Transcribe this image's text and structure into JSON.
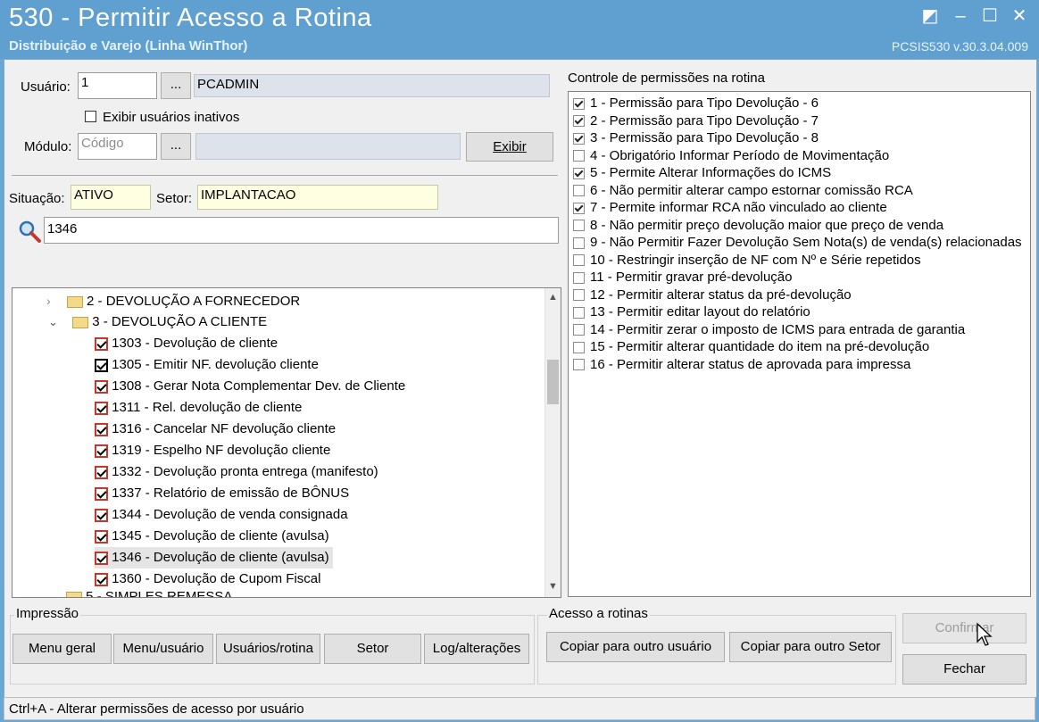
{
  "window": {
    "title": "530 - Permitir Acesso a Rotina",
    "subtitle": "Distribuição e Varejo (Linha WinThor)",
    "version": "PCSIS530  v.30.3.04.009"
  },
  "user": {
    "label": "Usuário:",
    "code": "1",
    "lookup_label": "...",
    "name": "PCADMIN",
    "show_inactive_label": "Exibir usuários inativos",
    "show_inactive": false
  },
  "module": {
    "label": "Módulo:",
    "code_placeholder": "Código",
    "lookup_label": "...",
    "name": "",
    "show_button": "Exibir"
  },
  "status": {
    "situacao_label": "Situação:",
    "situacao": "ATIVO",
    "setor_label": "Setor:",
    "setor": "IMPLANTACAO"
  },
  "search": {
    "value": "1346"
  },
  "tree": {
    "folders": [
      {
        "label": "2 - DEVOLUÇÃO A FORNECEDOR",
        "expanded": false
      },
      {
        "label": "3 - DEVOLUÇÃO A CLIENTE",
        "expanded": true
      },
      {
        "label": "5 - SIMPLES REMESSA",
        "expanded": false
      }
    ],
    "items": [
      {
        "label": "1303 - Devolução de cliente",
        "checked": true
      },
      {
        "label": "1305 - Emitir NF. devolução cliente",
        "checked": true
      },
      {
        "label": "1308 - Gerar Nota Complementar Dev. de Cliente",
        "checked": true
      },
      {
        "label": "1311 - Rel. devolução de cliente",
        "checked": true
      },
      {
        "label": "1316 - Cancelar NF devolução cliente",
        "checked": true
      },
      {
        "label": "1319 - Espelho NF devolução cliente",
        "checked": true
      },
      {
        "label": "1332 - Devolução pronta entrega (manifesto)",
        "checked": true
      },
      {
        "label": "1337 - Relatório de emissão de BÔNUS",
        "checked": true
      },
      {
        "label": "1344 - Devolução de venda consignada",
        "checked": true
      },
      {
        "label": "1345 - Devolução de cliente (avulsa)",
        "checked": true
      },
      {
        "label": "1346 - Devolução de cliente (avulsa)",
        "checked": true
      },
      {
        "label": "1360 - Devolução de Cupom Fiscal",
        "checked": true
      }
    ]
  },
  "permissions": {
    "title": "Controle de permissões na rotina",
    "items": [
      {
        "label": "1 - Permissão para Tipo Devolução - 6",
        "checked": true
      },
      {
        "label": "2 - Permissão para Tipo Devolução - 7",
        "checked": true
      },
      {
        "label": "3 - Permissão para Tipo Devolução - 8",
        "checked": true
      },
      {
        "label": "4 - Obrigatório Informar Período de Movimentação",
        "checked": false
      },
      {
        "label": "5 - Permite Alterar Informações do ICMS",
        "checked": true
      },
      {
        "label": "6 - Não permitir alterar campo estornar comissão RCA",
        "checked": false
      },
      {
        "label": "7 - Permite informar RCA não vinculado ao cliente",
        "checked": true
      },
      {
        "label": "8 - Não permitir preço devolução maior que preço de venda",
        "checked": false
      },
      {
        "label": "9 - Não Permitir Fazer Devolução Sem Nota(s) de venda(s) relacionadas",
        "checked": false
      },
      {
        "label": "10 - Restringir inserção de NF com Nº e Série repetidos",
        "checked": false
      },
      {
        "label": "11 - Permitir gravar pré-devolução",
        "checked": false
      },
      {
        "label": "12 - Permitir alterar status da pré-devolução",
        "checked": false
      },
      {
        "label": "13 - Permitir editar layout do relatório",
        "checked": false
      },
      {
        "label": "14 - Permitir zerar o imposto de ICMS para entrada de garantia",
        "checked": false
      },
      {
        "label": "15 - Permitir alterar quantidade do item na pré-devolução",
        "checked": false
      },
      {
        "label": "16 - Permitir alterar status de aprovada para impressa",
        "checked": false
      }
    ]
  },
  "printing": {
    "title": "Impressão",
    "buttons": [
      "Menu geral",
      "Menu/usuário",
      "Usuários/rotina",
      "Setor",
      "Log/alterações"
    ]
  },
  "access": {
    "title": "Acesso a rotinas",
    "copy_user": "Copiar para outro usuário",
    "copy_sector": "Copiar para outro Setor"
  },
  "actions": {
    "confirm": "Confirmar",
    "close": "Fechar"
  },
  "statusbar": {
    "text": "Ctrl+A - Alterar permissões de acesso por usuário"
  }
}
